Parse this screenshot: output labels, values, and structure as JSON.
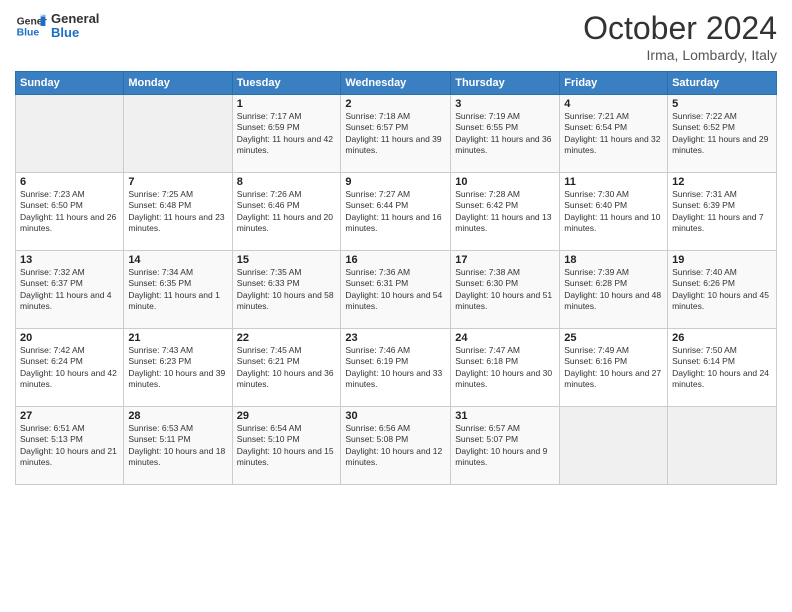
{
  "header": {
    "logo_line1": "General",
    "logo_line2": "Blue",
    "title": "October 2024",
    "subtitle": "Irma, Lombardy, Italy"
  },
  "weekdays": [
    "Sunday",
    "Monday",
    "Tuesday",
    "Wednesday",
    "Thursday",
    "Friday",
    "Saturday"
  ],
  "weeks": [
    [
      {
        "day": "",
        "info": ""
      },
      {
        "day": "",
        "info": ""
      },
      {
        "day": "1",
        "info": "Sunrise: 7:17 AM\nSunset: 6:59 PM\nDaylight: 11 hours and 42 minutes."
      },
      {
        "day": "2",
        "info": "Sunrise: 7:18 AM\nSunset: 6:57 PM\nDaylight: 11 hours and 39 minutes."
      },
      {
        "day": "3",
        "info": "Sunrise: 7:19 AM\nSunset: 6:55 PM\nDaylight: 11 hours and 36 minutes."
      },
      {
        "day": "4",
        "info": "Sunrise: 7:21 AM\nSunset: 6:54 PM\nDaylight: 11 hours and 32 minutes."
      },
      {
        "day": "5",
        "info": "Sunrise: 7:22 AM\nSunset: 6:52 PM\nDaylight: 11 hours and 29 minutes."
      }
    ],
    [
      {
        "day": "6",
        "info": "Sunrise: 7:23 AM\nSunset: 6:50 PM\nDaylight: 11 hours and 26 minutes."
      },
      {
        "day": "7",
        "info": "Sunrise: 7:25 AM\nSunset: 6:48 PM\nDaylight: 11 hours and 23 minutes."
      },
      {
        "day": "8",
        "info": "Sunrise: 7:26 AM\nSunset: 6:46 PM\nDaylight: 11 hours and 20 minutes."
      },
      {
        "day": "9",
        "info": "Sunrise: 7:27 AM\nSunset: 6:44 PM\nDaylight: 11 hours and 16 minutes."
      },
      {
        "day": "10",
        "info": "Sunrise: 7:28 AM\nSunset: 6:42 PM\nDaylight: 11 hours and 13 minutes."
      },
      {
        "day": "11",
        "info": "Sunrise: 7:30 AM\nSunset: 6:40 PM\nDaylight: 11 hours and 10 minutes."
      },
      {
        "day": "12",
        "info": "Sunrise: 7:31 AM\nSunset: 6:39 PM\nDaylight: 11 hours and 7 minutes."
      }
    ],
    [
      {
        "day": "13",
        "info": "Sunrise: 7:32 AM\nSunset: 6:37 PM\nDaylight: 11 hours and 4 minutes."
      },
      {
        "day": "14",
        "info": "Sunrise: 7:34 AM\nSunset: 6:35 PM\nDaylight: 11 hours and 1 minute."
      },
      {
        "day": "15",
        "info": "Sunrise: 7:35 AM\nSunset: 6:33 PM\nDaylight: 10 hours and 58 minutes."
      },
      {
        "day": "16",
        "info": "Sunrise: 7:36 AM\nSunset: 6:31 PM\nDaylight: 10 hours and 54 minutes."
      },
      {
        "day": "17",
        "info": "Sunrise: 7:38 AM\nSunset: 6:30 PM\nDaylight: 10 hours and 51 minutes."
      },
      {
        "day": "18",
        "info": "Sunrise: 7:39 AM\nSunset: 6:28 PM\nDaylight: 10 hours and 48 minutes."
      },
      {
        "day": "19",
        "info": "Sunrise: 7:40 AM\nSunset: 6:26 PM\nDaylight: 10 hours and 45 minutes."
      }
    ],
    [
      {
        "day": "20",
        "info": "Sunrise: 7:42 AM\nSunset: 6:24 PM\nDaylight: 10 hours and 42 minutes."
      },
      {
        "day": "21",
        "info": "Sunrise: 7:43 AM\nSunset: 6:23 PM\nDaylight: 10 hours and 39 minutes."
      },
      {
        "day": "22",
        "info": "Sunrise: 7:45 AM\nSunset: 6:21 PM\nDaylight: 10 hours and 36 minutes."
      },
      {
        "day": "23",
        "info": "Sunrise: 7:46 AM\nSunset: 6:19 PM\nDaylight: 10 hours and 33 minutes."
      },
      {
        "day": "24",
        "info": "Sunrise: 7:47 AM\nSunset: 6:18 PM\nDaylight: 10 hours and 30 minutes."
      },
      {
        "day": "25",
        "info": "Sunrise: 7:49 AM\nSunset: 6:16 PM\nDaylight: 10 hours and 27 minutes."
      },
      {
        "day": "26",
        "info": "Sunrise: 7:50 AM\nSunset: 6:14 PM\nDaylight: 10 hours and 24 minutes."
      }
    ],
    [
      {
        "day": "27",
        "info": "Sunrise: 6:51 AM\nSunset: 5:13 PM\nDaylight: 10 hours and 21 minutes."
      },
      {
        "day": "28",
        "info": "Sunrise: 6:53 AM\nSunset: 5:11 PM\nDaylight: 10 hours and 18 minutes."
      },
      {
        "day": "29",
        "info": "Sunrise: 6:54 AM\nSunset: 5:10 PM\nDaylight: 10 hours and 15 minutes."
      },
      {
        "day": "30",
        "info": "Sunrise: 6:56 AM\nSunset: 5:08 PM\nDaylight: 10 hours and 12 minutes."
      },
      {
        "day": "31",
        "info": "Sunrise: 6:57 AM\nSunset: 5:07 PM\nDaylight: 10 hours and 9 minutes."
      },
      {
        "day": "",
        "info": ""
      },
      {
        "day": "",
        "info": ""
      }
    ]
  ]
}
